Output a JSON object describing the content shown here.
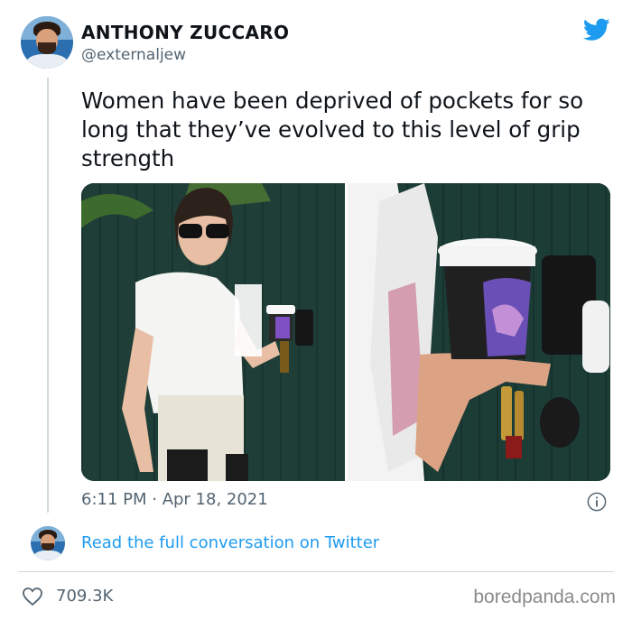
{
  "tweet": {
    "author_name": "ANTHONY ZUCCARO",
    "author_handle": "@externaljew",
    "text": "Women have been deprived of pockets for so long that they’ve evolved to this level of grip strength",
    "timestamp": "6:11 PM · Apr 18, 2021",
    "conversation_link": "Read the full conversation on Twitter",
    "likes": "709.3K"
  },
  "watermark": "boredpanda.com",
  "icons": {
    "brand": "twitter-bird-icon",
    "info": "info-icon",
    "like": "heart-icon"
  },
  "colors": {
    "twitter_blue": "#1d9bf0",
    "secondary_text": "#536471",
    "divider": "#cfd9de"
  }
}
